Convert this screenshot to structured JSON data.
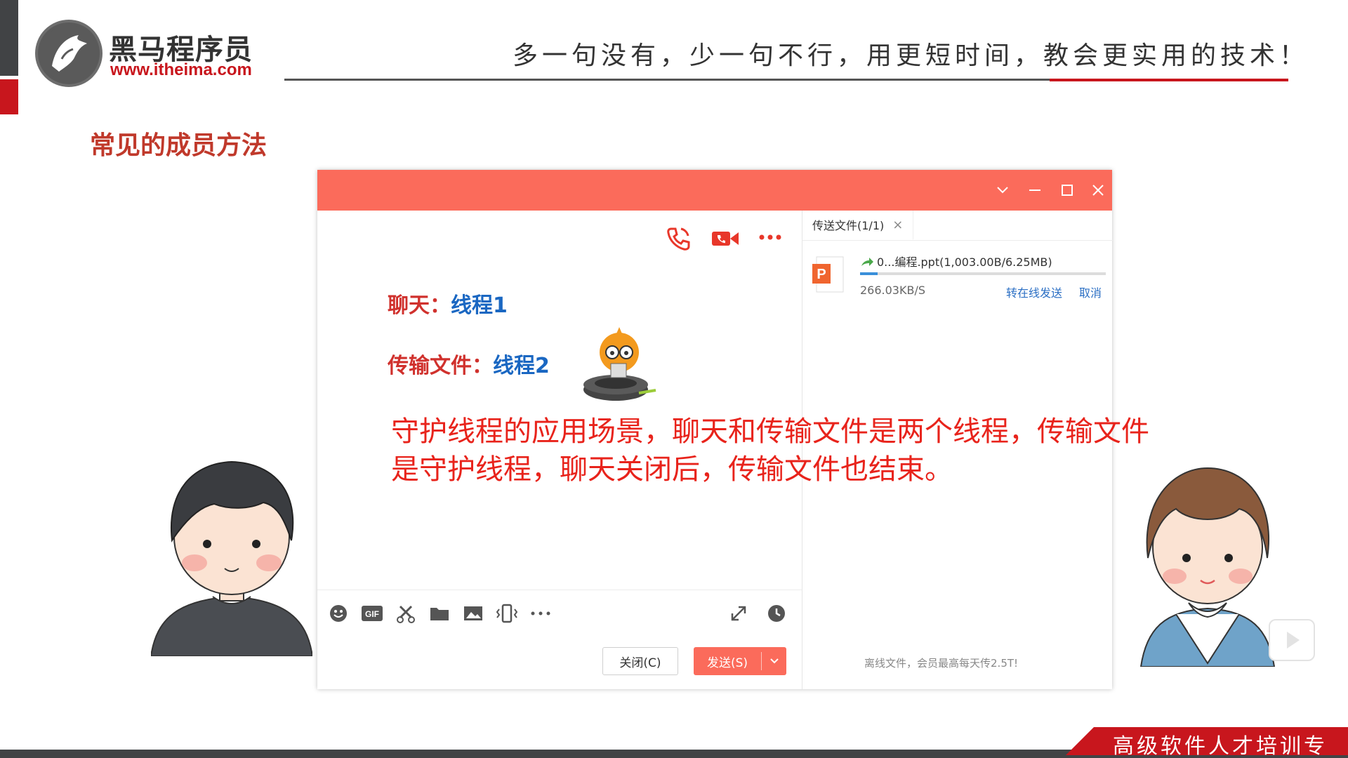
{
  "brand": {
    "name": "黑马程序员",
    "url": "www.itheima.com",
    "slogan": "多一句没有，少一句不行，用更短时间，教会更实用的技术！",
    "footer": "高级软件人才培训专家",
    "accent_color": "#c8161d"
  },
  "slide": {
    "title": "常见的成员方法"
  },
  "chat_window": {
    "titlebar_color": "#fb6b5b",
    "titlebar_icons": [
      "chevron-down-icon",
      "minimize-icon",
      "maximize-icon",
      "close-icon"
    ],
    "top_icons": [
      "phone-icon",
      "video-call-icon",
      "more-icon"
    ],
    "chat_line": {
      "label": "聊天：",
      "value": "线程1"
    },
    "file_line": {
      "label": "传输文件：",
      "value": "线程2"
    },
    "toolbar_icons": [
      "emoji-icon",
      "gif-icon",
      "scissors-icon",
      "folder-icon",
      "image-icon",
      "vibrate-icon",
      "more-icon",
      "expand-icon",
      "history-icon"
    ],
    "gif_label": "GIF",
    "close_button": "关闭(C)",
    "send_button": "发送(S)"
  },
  "transfer_panel": {
    "tab_label": "传送文件(1/1)",
    "file_name": "0...编程.ppt(1,003.00B/6.25MB)",
    "file_icon_letter": "P",
    "progress": 0.07,
    "speed": "266.03KB/S",
    "online_send_link": "转在线发送",
    "cancel_link": "取消",
    "offline_note": "离线文件，会员最高每天传2.5T!"
  },
  "caption": {
    "line1": "守护线程的应用场景，聊天和传输文件是两个线程，传输文件",
    "line2": "是守护线程，聊天关闭后，传输文件也结束。"
  }
}
